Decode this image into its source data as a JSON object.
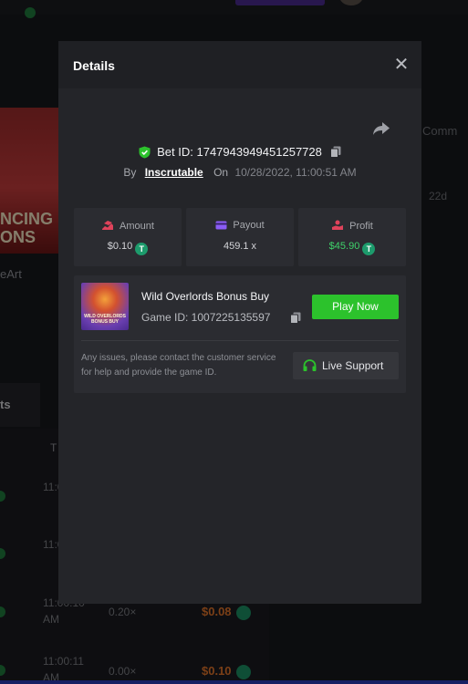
{
  "background": {
    "game_caption": "eArt",
    "game_thumb_words": [
      "NCING",
      "ONS"
    ],
    "right_label": "Comm",
    "right_time": "22d",
    "tab_label": "ts",
    "table_header": "T",
    "rows": [
      {
        "time": "11:0",
        "mult": "",
        "value": ""
      },
      {
        "time": "11:0",
        "mult": "",
        "value": ""
      },
      {
        "time": "11:00:10 AM",
        "mult": "0.20×",
        "value": "$0.08"
      },
      {
        "time": "11:00:11 AM",
        "mult": "0.00×",
        "value": "$0.10"
      }
    ]
  },
  "modal": {
    "title": "Details",
    "close_label": "✕",
    "bet_id_label": "Bet ID: 1747943949451257728",
    "by_label": "By",
    "user": "Inscrutable",
    "on_label": "On",
    "date": "10/28/2022, 11:00:51 AM",
    "stats": {
      "amount": {
        "label": "Amount",
        "value": "$0.10",
        "icon": "amount-icon"
      },
      "payout": {
        "label": "Payout",
        "value": "459.1 x",
        "icon": "card-icon"
      },
      "profit": {
        "label": "Profit",
        "value": "$45.90",
        "icon": "profit-icon"
      }
    },
    "coin_symbol": "T",
    "game": {
      "name": "Wild Overlords Bonus Buy",
      "id_label": "Game ID: 1007225135597",
      "thumb_text": "WILD OVERLORDS BONUS BUY",
      "play_label": "Play Now"
    },
    "support": {
      "text": "Any issues, please contact the customer service for help and provide the game ID.",
      "button_label": "Live Support"
    }
  },
  "colors": {
    "accent_green": "#2cc22c",
    "profit_green": "#3fd26a",
    "coin": "#1d9b6c",
    "loss_orange": "#e0732a"
  }
}
